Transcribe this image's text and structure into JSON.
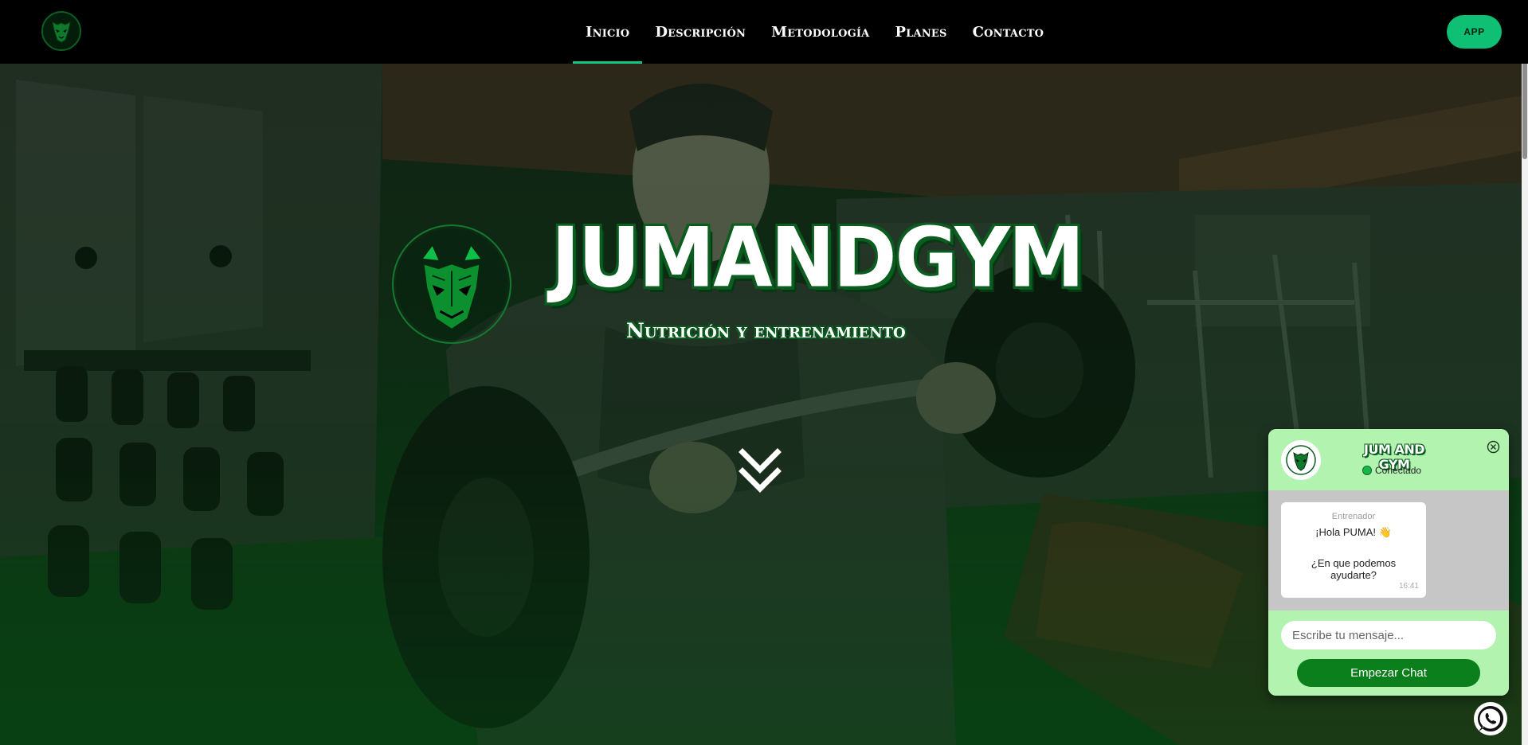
{
  "nav": {
    "logo_icon": "panther-mask-logo-icon",
    "links": [
      {
        "label": "Inicio",
        "active": true
      },
      {
        "label": "Descripción",
        "active": false
      },
      {
        "label": "Metodología",
        "active": false
      },
      {
        "label": "Planes",
        "active": false
      },
      {
        "label": "Contacto",
        "active": false
      }
    ],
    "app_button": "APP"
  },
  "hero": {
    "title": "JUMANDGYM",
    "subtitle": "Nutrición y entrenamiento",
    "emblem_icon": "panther-mask-emblem-icon",
    "scroll_icon": "double-chevron-down-icon"
  },
  "chat": {
    "brand": "JUM AND GYM",
    "status": "Conectado",
    "message": {
      "sender": "Entrenador",
      "line1": "¡Hola PUMA! 👋",
      "line2": "¿En que podemos ayudarte?",
      "time": "16:41"
    },
    "input_placeholder": "Escribe tu mensaje...",
    "start_button": "Empezar Chat"
  },
  "whatsapp_icon": "whatsapp-icon",
  "colors": {
    "accent": "#16c784",
    "app_button": "#0fbf73",
    "brand_green": "#0a5c1f",
    "chat_panel": "#b3f3b0",
    "chat_button": "#0a7f1c"
  }
}
